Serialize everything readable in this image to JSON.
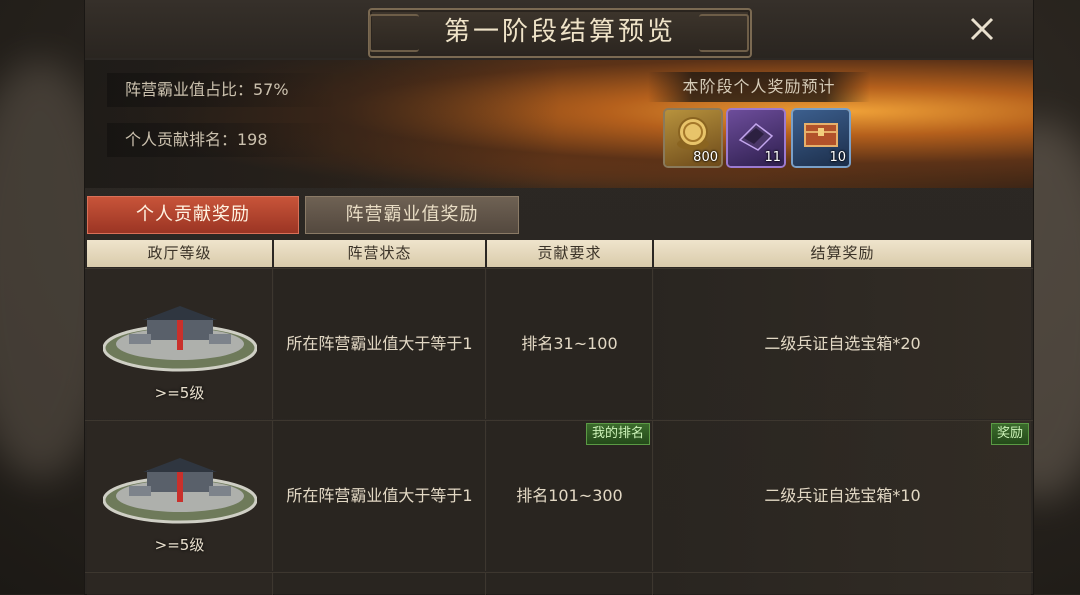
{
  "title": "第一阶段结算预览",
  "stats": {
    "faction_ratio": "阵营霸业值占比：57%",
    "personal_rank": "个人贡献排名：198"
  },
  "reward_preview": {
    "heading": "本阶段个人奖励预计",
    "items": [
      {
        "icon": "gold-coin-icon",
        "count": "800"
      },
      {
        "icon": "purple-crystal-icon",
        "count": "11"
      },
      {
        "icon": "treasure-chest-icon",
        "count": "10"
      }
    ]
  },
  "tabs": {
    "personal": "个人贡献奖励",
    "faction": "阵营霸业值奖励"
  },
  "table": {
    "headers": [
      "政厅等级",
      "阵营状态",
      "贡献要求",
      "结算奖励"
    ],
    "rows": [
      {
        "level": ">=5级",
        "state": "所在阵营霸业值大于等于1",
        "requirement": "排名31~100",
        "reward": "二级兵证自选宝箱*20",
        "tag_mid": "",
        "tag_right": ""
      },
      {
        "level": ">=5级",
        "state": "所在阵营霸业值大于等于1",
        "requirement": "排名101~300",
        "reward": "二级兵证自选宝箱*10",
        "tag_mid": "我的排名",
        "tag_right": "奖励"
      }
    ]
  }
}
